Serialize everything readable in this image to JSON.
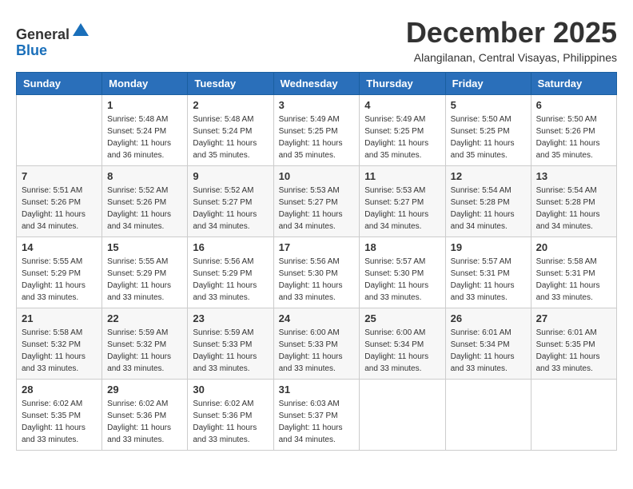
{
  "logo": {
    "general": "General",
    "blue": "Blue"
  },
  "title": {
    "month_year": "December 2025",
    "location": "Alangilanan, Central Visayas, Philippines"
  },
  "headers": [
    "Sunday",
    "Monday",
    "Tuesday",
    "Wednesday",
    "Thursday",
    "Friday",
    "Saturday"
  ],
  "weeks": [
    [
      {
        "day": "",
        "sunrise": "",
        "sunset": "",
        "daylight": ""
      },
      {
        "day": "1",
        "sunrise": "Sunrise: 5:48 AM",
        "sunset": "Sunset: 5:24 PM",
        "daylight": "Daylight: 11 hours and 36 minutes."
      },
      {
        "day": "2",
        "sunrise": "Sunrise: 5:48 AM",
        "sunset": "Sunset: 5:24 PM",
        "daylight": "Daylight: 11 hours and 35 minutes."
      },
      {
        "day": "3",
        "sunrise": "Sunrise: 5:49 AM",
        "sunset": "Sunset: 5:25 PM",
        "daylight": "Daylight: 11 hours and 35 minutes."
      },
      {
        "day": "4",
        "sunrise": "Sunrise: 5:49 AM",
        "sunset": "Sunset: 5:25 PM",
        "daylight": "Daylight: 11 hours and 35 minutes."
      },
      {
        "day": "5",
        "sunrise": "Sunrise: 5:50 AM",
        "sunset": "Sunset: 5:25 PM",
        "daylight": "Daylight: 11 hours and 35 minutes."
      },
      {
        "day": "6",
        "sunrise": "Sunrise: 5:50 AM",
        "sunset": "Sunset: 5:26 PM",
        "daylight": "Daylight: 11 hours and 35 minutes."
      }
    ],
    [
      {
        "day": "7",
        "sunrise": "Sunrise: 5:51 AM",
        "sunset": "Sunset: 5:26 PM",
        "daylight": "Daylight: 11 hours and 34 minutes."
      },
      {
        "day": "8",
        "sunrise": "Sunrise: 5:52 AM",
        "sunset": "Sunset: 5:26 PM",
        "daylight": "Daylight: 11 hours and 34 minutes."
      },
      {
        "day": "9",
        "sunrise": "Sunrise: 5:52 AM",
        "sunset": "Sunset: 5:27 PM",
        "daylight": "Daylight: 11 hours and 34 minutes."
      },
      {
        "day": "10",
        "sunrise": "Sunrise: 5:53 AM",
        "sunset": "Sunset: 5:27 PM",
        "daylight": "Daylight: 11 hours and 34 minutes."
      },
      {
        "day": "11",
        "sunrise": "Sunrise: 5:53 AM",
        "sunset": "Sunset: 5:27 PM",
        "daylight": "Daylight: 11 hours and 34 minutes."
      },
      {
        "day": "12",
        "sunrise": "Sunrise: 5:54 AM",
        "sunset": "Sunset: 5:28 PM",
        "daylight": "Daylight: 11 hours and 34 minutes."
      },
      {
        "day": "13",
        "sunrise": "Sunrise: 5:54 AM",
        "sunset": "Sunset: 5:28 PM",
        "daylight": "Daylight: 11 hours and 34 minutes."
      }
    ],
    [
      {
        "day": "14",
        "sunrise": "Sunrise: 5:55 AM",
        "sunset": "Sunset: 5:29 PM",
        "daylight": "Daylight: 11 hours and 33 minutes."
      },
      {
        "day": "15",
        "sunrise": "Sunrise: 5:55 AM",
        "sunset": "Sunset: 5:29 PM",
        "daylight": "Daylight: 11 hours and 33 minutes."
      },
      {
        "day": "16",
        "sunrise": "Sunrise: 5:56 AM",
        "sunset": "Sunset: 5:29 PM",
        "daylight": "Daylight: 11 hours and 33 minutes."
      },
      {
        "day": "17",
        "sunrise": "Sunrise: 5:56 AM",
        "sunset": "Sunset: 5:30 PM",
        "daylight": "Daylight: 11 hours and 33 minutes."
      },
      {
        "day": "18",
        "sunrise": "Sunrise: 5:57 AM",
        "sunset": "Sunset: 5:30 PM",
        "daylight": "Daylight: 11 hours and 33 minutes."
      },
      {
        "day": "19",
        "sunrise": "Sunrise: 5:57 AM",
        "sunset": "Sunset: 5:31 PM",
        "daylight": "Daylight: 11 hours and 33 minutes."
      },
      {
        "day": "20",
        "sunrise": "Sunrise: 5:58 AM",
        "sunset": "Sunset: 5:31 PM",
        "daylight": "Daylight: 11 hours and 33 minutes."
      }
    ],
    [
      {
        "day": "21",
        "sunrise": "Sunrise: 5:58 AM",
        "sunset": "Sunset: 5:32 PM",
        "daylight": "Daylight: 11 hours and 33 minutes."
      },
      {
        "day": "22",
        "sunrise": "Sunrise: 5:59 AM",
        "sunset": "Sunset: 5:32 PM",
        "daylight": "Daylight: 11 hours and 33 minutes."
      },
      {
        "day": "23",
        "sunrise": "Sunrise: 5:59 AM",
        "sunset": "Sunset: 5:33 PM",
        "daylight": "Daylight: 11 hours and 33 minutes."
      },
      {
        "day": "24",
        "sunrise": "Sunrise: 6:00 AM",
        "sunset": "Sunset: 5:33 PM",
        "daylight": "Daylight: 11 hours and 33 minutes."
      },
      {
        "day": "25",
        "sunrise": "Sunrise: 6:00 AM",
        "sunset": "Sunset: 5:34 PM",
        "daylight": "Daylight: 11 hours and 33 minutes."
      },
      {
        "day": "26",
        "sunrise": "Sunrise: 6:01 AM",
        "sunset": "Sunset: 5:34 PM",
        "daylight": "Daylight: 11 hours and 33 minutes."
      },
      {
        "day": "27",
        "sunrise": "Sunrise: 6:01 AM",
        "sunset": "Sunset: 5:35 PM",
        "daylight": "Daylight: 11 hours and 33 minutes."
      }
    ],
    [
      {
        "day": "28",
        "sunrise": "Sunrise: 6:02 AM",
        "sunset": "Sunset: 5:35 PM",
        "daylight": "Daylight: 11 hours and 33 minutes."
      },
      {
        "day": "29",
        "sunrise": "Sunrise: 6:02 AM",
        "sunset": "Sunset: 5:36 PM",
        "daylight": "Daylight: 11 hours and 33 minutes."
      },
      {
        "day": "30",
        "sunrise": "Sunrise: 6:02 AM",
        "sunset": "Sunset: 5:36 PM",
        "daylight": "Daylight: 11 hours and 33 minutes."
      },
      {
        "day": "31",
        "sunrise": "Sunrise: 6:03 AM",
        "sunset": "Sunset: 5:37 PM",
        "daylight": "Daylight: 11 hours and 34 minutes."
      },
      {
        "day": "",
        "sunrise": "",
        "sunset": "",
        "daylight": ""
      },
      {
        "day": "",
        "sunrise": "",
        "sunset": "",
        "daylight": ""
      },
      {
        "day": "",
        "sunrise": "",
        "sunset": "",
        "daylight": ""
      }
    ]
  ]
}
